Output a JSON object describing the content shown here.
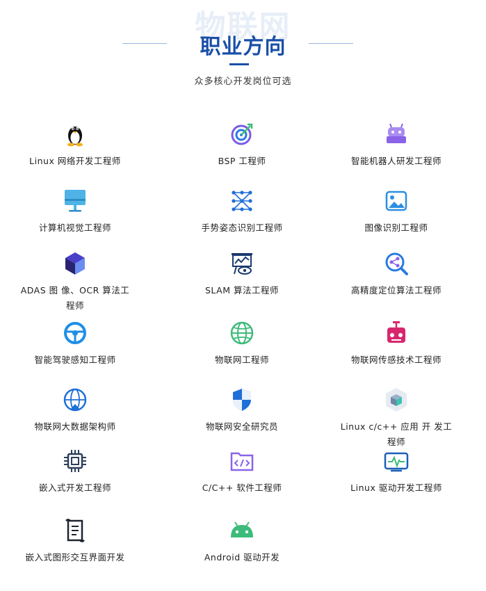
{
  "header": {
    "watermark": "物联网",
    "title": "职业方向",
    "subtitle": "众多核心开发岗位可选"
  },
  "items": [
    {
      "label": "Linux 网络开发工程师",
      "icon": "penguin-icon"
    },
    {
      "label": "BSP 工程师",
      "icon": "target-icon"
    },
    {
      "label": "智能机器人研发工程师",
      "icon": "robot-icon"
    },
    {
      "label": "计算机视觉工程师",
      "icon": "monitor-icon"
    },
    {
      "label": "手势姿态识别工程师",
      "icon": "network-nodes-icon"
    },
    {
      "label": "图像识别工程师",
      "icon": "image-icon"
    },
    {
      "label": "ADAS 图 像、OCR 算法工程师",
      "icon": "cube-icon"
    },
    {
      "label": "SLAM 算法工程师",
      "icon": "presentation-eye-icon"
    },
    {
      "label": "高精度定位算法工程师",
      "icon": "magnifier-share-icon"
    },
    {
      "label": "智能驾驶感知工程师",
      "icon": "steering-wheel-icon"
    },
    {
      "label": "物联网工程师",
      "icon": "globe-icon"
    },
    {
      "label": "物联网传感技术工程师",
      "icon": "sensor-icon"
    },
    {
      "label": "物联网大数据架构师",
      "icon": "cloud-globe-icon"
    },
    {
      "label": "物联网安全研究员",
      "icon": "shield-icon"
    },
    {
      "label": "Linux c/c++ 应用 开 发工程师",
      "icon": "hexagon-cube-icon"
    },
    {
      "label": "嵌入式开发工程师",
      "icon": "chip-icon"
    },
    {
      "label": "C/C++ 软件工程师",
      "icon": "code-folder-icon"
    },
    {
      "label": "Linux 驱动开发工程师",
      "icon": "pulse-board-icon"
    },
    {
      "label": "嵌入式图形交互界面开发",
      "icon": "scroll-icon"
    },
    {
      "label": "Android 驱动开发",
      "icon": "android-icon"
    }
  ],
  "colors": {
    "title": "#1a4fa8",
    "blue": "#1f6fd8",
    "purple": "#8a63e8",
    "green": "#3dbb7a",
    "pink": "#d8266d"
  }
}
